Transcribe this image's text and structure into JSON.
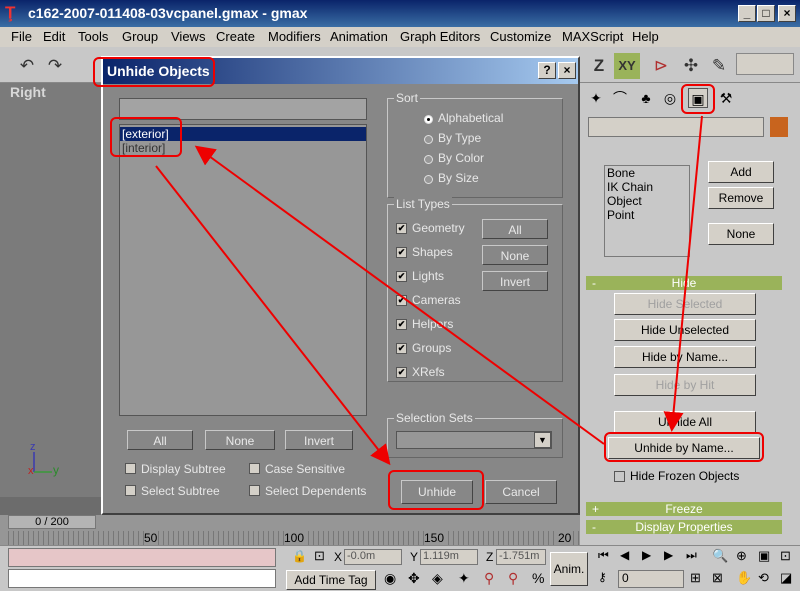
{
  "app": {
    "title": "c162-2007-011408-03vcpanel.gmax  - gmax",
    "icon": "gmax-logo-icon",
    "controls": {
      "minimize": "_",
      "maximize": "□",
      "close": "×"
    }
  },
  "menu": [
    "File",
    "Edit",
    "Tools",
    "Group",
    "Views",
    "Create",
    "Modifiers",
    "Animation",
    "Graph Editors",
    "Customize",
    "MAXScript",
    "Help"
  ],
  "toolbar": {
    "axis_z": "Z",
    "axis_xy": "XY"
  },
  "viewport": {
    "label": "Right",
    "axis_x": "x",
    "axis_y": "y",
    "axis_z": "z"
  },
  "dialog": {
    "title": "Unhide Objects",
    "help_btn": "?",
    "close_btn": "×",
    "filter_value": "",
    "objects": [
      "[exterior]",
      "[interior]"
    ],
    "list_buttons": {
      "all": "All",
      "none": "None",
      "invert": "Invert"
    },
    "options": {
      "display_subtree": "Display Subtree",
      "case_sensitive": "Case Sensitive",
      "select_subtree": "Select Subtree",
      "select_dependents": "Select Dependents"
    },
    "sort": {
      "label": "Sort",
      "options": [
        "Alphabetical",
        "By Type",
        "By Color",
        "By Size"
      ],
      "selected": "Alphabetical"
    },
    "list_types": {
      "label": "List Types",
      "items": [
        "Geometry",
        "Shapes",
        "Lights",
        "Cameras",
        "Helpers",
        "Groups",
        "XRefs"
      ],
      "buttons": {
        "all": "All",
        "none": "None",
        "invert": "Invert"
      }
    },
    "selection_sets": {
      "label": "Selection Sets",
      "value": ""
    },
    "actions": {
      "unhide": "Unhide",
      "cancel": "Cancel"
    }
  },
  "command_panel": {
    "objects": [
      "Bone",
      "IK Chain Object",
      "Point"
    ],
    "obj_buttons": {
      "add": "Add",
      "remove": "Remove",
      "none": "None"
    },
    "hide_rollout": {
      "sign": "-",
      "title": "Hide",
      "buttons": {
        "hide_selected": "Hide Selected",
        "hide_unselected": "Hide Unselected",
        "hide_by_name": "Hide by Name...",
        "hide_by_hit": "Hide by Hit",
        "unhide_all": "Unhide All",
        "unhide_by_name": "Unhide by Name..."
      },
      "hide_frozen": "Hide Frozen Objects"
    },
    "freeze_rollout": {
      "sign": "+",
      "title": "Freeze"
    },
    "display_rollout": {
      "sign": "-",
      "title": "Display Properties"
    }
  },
  "timeline": {
    "frame": "0 / 200",
    "ticks": [
      "50",
      "100",
      "150",
      "20"
    ]
  },
  "status": {
    "x_label": "X",
    "x_value": "-0.0m",
    "y_label": "Y",
    "y_value": "1.119m",
    "z_label": "Z",
    "z_value": "-1.751m",
    "add_time_tag": "Add Time Tag",
    "anim": "Anim.",
    "frame_value": "0"
  },
  "colors": {
    "annotation": "#e00000",
    "selection": "#0a246a",
    "rollout": "#9ab35a",
    "swatch": "#c8641e"
  }
}
